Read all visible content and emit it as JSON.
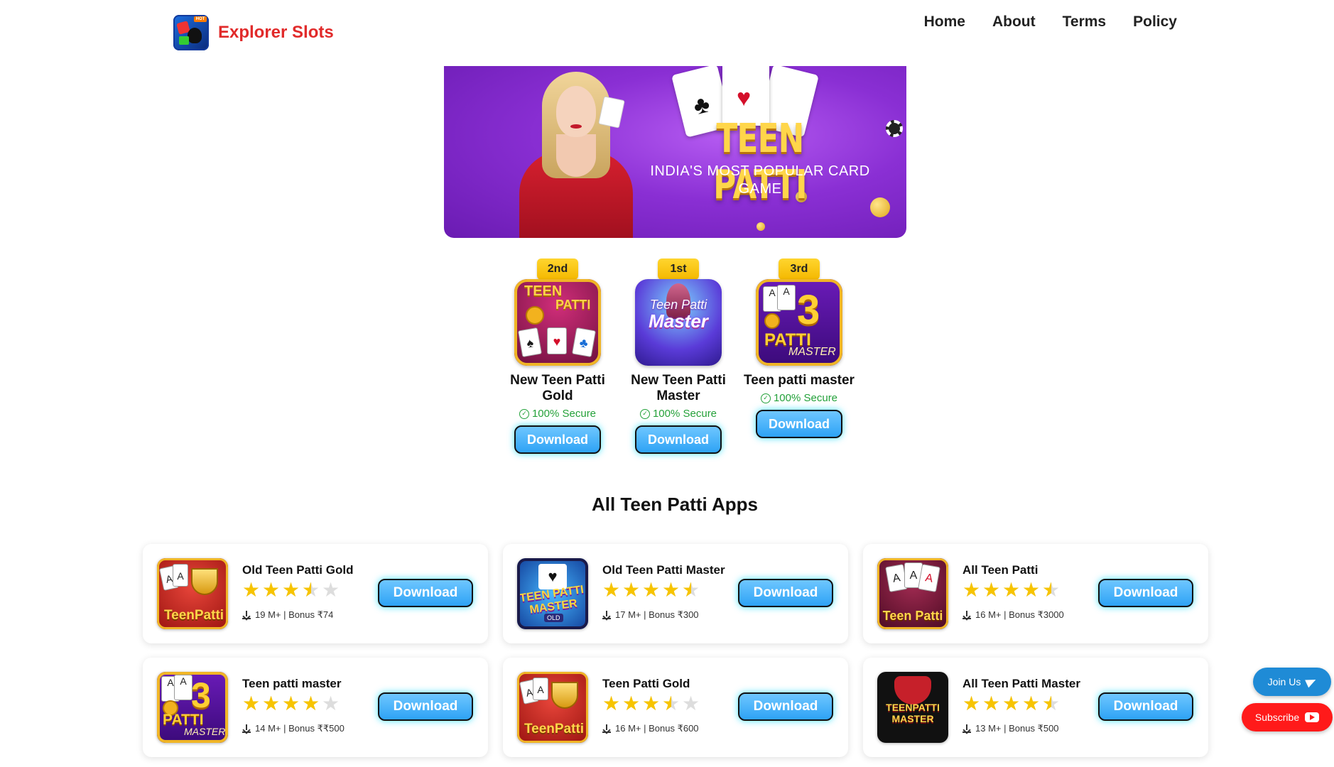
{
  "header": {
    "brand_name": "Explorer Slots",
    "nav": [
      "Home",
      "About",
      "Terms",
      "Policy"
    ]
  },
  "banner": {
    "title": "TEEN PATTI",
    "subtitle": "INDIA'S MOST POPULAR CARD GAME"
  },
  "top_apps": [
    {
      "rank": "2nd",
      "name": "New Teen Patti Gold",
      "secure": "100% Secure",
      "button": "Download",
      "icon": "teen-patti-gold-icon"
    },
    {
      "rank": "1st",
      "name": "New Teen Patti Master",
      "secure": "100% Secure",
      "button": "Download",
      "icon": "teen-patti-master-icon"
    },
    {
      "rank": "3rd",
      "name": "Teen patti master",
      "secure": "100% Secure",
      "button": "Download",
      "icon": "patti-master-3-icon"
    }
  ],
  "section_title": "All Teen Patti Apps",
  "apps": [
    {
      "name": "Old Teen Patti Gold",
      "rating": 3.5,
      "meta": "19 M+ | Bonus ₹74",
      "button": "Download",
      "icon": "old-teen-patti-gold-icon"
    },
    {
      "name": "Old Teen Patti Master",
      "rating": 4.5,
      "meta": "17 M+ | Bonus ₹300",
      "button": "Download",
      "icon": "old-teen-patti-master-icon"
    },
    {
      "name": "All Teen Patti",
      "rating": 4.5,
      "meta": "16 M+ | Bonus ₹3000",
      "button": "Download",
      "icon": "all-teen-patti-icon"
    },
    {
      "name": "Teen patti master",
      "rating": 4,
      "meta": "14 M+ | Bonus ₹₹500",
      "button": "Download",
      "icon": "patti-master-3-icon"
    },
    {
      "name": "Teen Patti Gold",
      "rating": 3.5,
      "meta": "16 M+ | Bonus ₹600",
      "button": "Download",
      "icon": "teen-patti-gold-trophy-icon"
    },
    {
      "name": "All Teen Patti Master",
      "rating": 4.5,
      "meta": "13 M+ | Bonus ₹500",
      "button": "Download",
      "icon": "all-teen-patti-master-icon"
    }
  ],
  "floating": {
    "join": "Join Us",
    "subscribe": "Subscribe"
  },
  "colors": {
    "brand": "#e12a2a",
    "button": "#2ea3f5",
    "rank_badge": "#f4b800",
    "secure": "#23a13a",
    "star": "#f7c400",
    "join": "#1f8bd6",
    "subscribe": "#ff1a1a"
  }
}
